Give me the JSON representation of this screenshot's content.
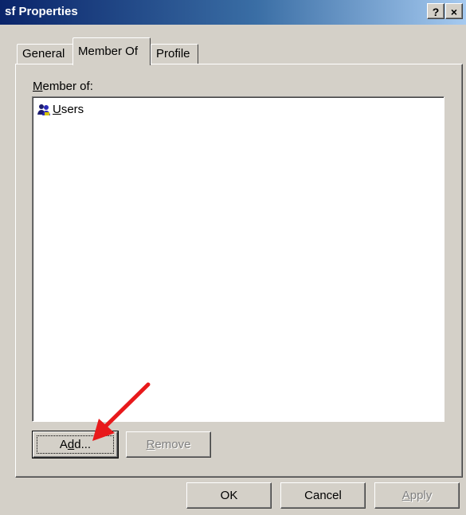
{
  "window": {
    "title": "sf Properties",
    "help_button": "?",
    "close_button": "×"
  },
  "tabs": [
    {
      "label": "General",
      "active": false
    },
    {
      "label": "Member Of",
      "active": true
    },
    {
      "label": "Profile",
      "active": false
    }
  ],
  "member_of": {
    "label_prefix": "M",
    "label_rest": "ember of:",
    "items": [
      {
        "label_prefix": "U",
        "label_rest": "sers",
        "icon": "user-group-icon"
      }
    ]
  },
  "buttons": {
    "add": {
      "pre": "A",
      "key": "d",
      "post": "d..."
    },
    "remove": {
      "key": "R",
      "post": "emove",
      "enabled": false
    },
    "ok": "OK",
    "cancel": "Cancel",
    "apply": {
      "key": "A",
      "post": "pply",
      "enabled": false
    }
  },
  "annotation": {
    "type": "arrow",
    "color": "#e8191b",
    "target": "add-button"
  }
}
